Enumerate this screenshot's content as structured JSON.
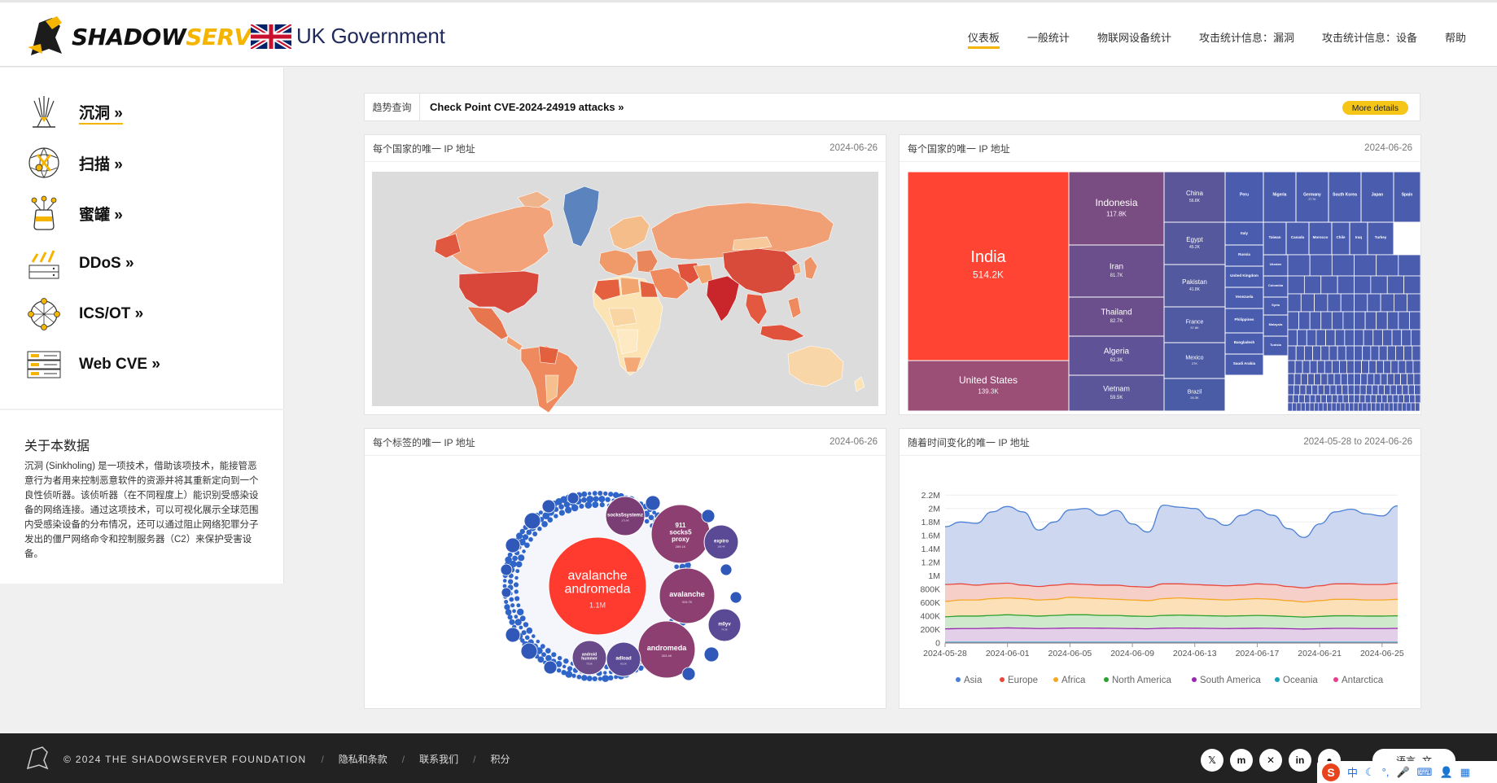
{
  "header": {
    "logo": {
      "part1": "SHADOW",
      "part2": "SERVER"
    },
    "partner": "UK Government",
    "nav": [
      {
        "label": "仪表板",
        "active": true
      },
      {
        "label": "一般统计"
      },
      {
        "label": "物联网设备统计"
      },
      {
        "label": "攻击统计信息：漏洞"
      },
      {
        "label": "攻击统计信息：设备"
      },
      {
        "label": "帮助"
      }
    ]
  },
  "sidebar": {
    "items": [
      {
        "label": "沉洞 »",
        "icon": "sinkhole-icon"
      },
      {
        "label": "扫描 »",
        "icon": "scan-icon"
      },
      {
        "label": "蜜罐 »",
        "icon": "honeypot-icon"
      },
      {
        "label": "DDoS »",
        "icon": "ddos-icon"
      },
      {
        "label": "ICS/OT »",
        "icon": "ics-icon"
      },
      {
        "label": "Web CVE »",
        "icon": "webcve-icon"
      }
    ],
    "about": {
      "title": "关于本数据",
      "text": "沉洞 (Sinkholing) 是一项技术，借助该项技术，能接管恶意行为者用来控制恶意软件的资源并将其重新定向到一个良性侦听器。该侦听器（在不同程度上）能识别受感染设备的网络连接。通过这项技术，可以可视化展示全球范围内受感染设备的分布情况，还可以通过阻止网络犯罪分子发出的僵尸网络命令和控制服务器（C2）来保护受害设备。"
    }
  },
  "trend": {
    "label": "趋势查询",
    "text": "Check Point CVE-2024-24919 attacks »",
    "button": "More details"
  },
  "panels": {
    "map": {
      "title": "每个国家的唯一 IP 地址",
      "date": "2024-06-26"
    },
    "treemap": {
      "title": "每个国家的唯一 IP 地址",
      "date": "2024-06-26"
    },
    "bubbles": {
      "title": "每个标签的唯一 IP 地址",
      "date": "2024-06-26"
    },
    "timeseries": {
      "title": "随着时间变化的唯一 IP 地址",
      "date": "2024-05-28 to 2024-06-26"
    }
  },
  "colors": {
    "accent": "#f5b400",
    "india": "#ff4433",
    "treemap_blue": "#4a5cae",
    "treemap_purple": "#6b5aa0"
  },
  "chart_data": [
    {
      "type": "treemap",
      "title": "每个国家的唯一 IP 地址",
      "items": [
        {
          "name": "India",
          "value": "514.2K"
        },
        {
          "name": "United States",
          "value": "139.3K"
        },
        {
          "name": "Indonesia",
          "value": "117.8K"
        },
        {
          "name": "Iran",
          "value": "81.7K"
        },
        {
          "name": "Thailand",
          "value": "82.7K"
        },
        {
          "name": "Algeria",
          "value": "62.3K"
        },
        {
          "name": "Vietnam",
          "value": "59.5K"
        },
        {
          "name": "China",
          "value": "56.8K"
        },
        {
          "name": "Egypt",
          "value": "45.2K"
        },
        {
          "name": "Pakistan",
          "value": "41.8K"
        },
        {
          "name": "France",
          "value": "37.8K"
        },
        {
          "name": "Mexico",
          "value": "27K"
        },
        {
          "name": "Brazil",
          "value": "26.3K"
        },
        {
          "name": "Peru",
          "value": "",
          "short": true
        },
        {
          "name": "Nigeria",
          "value": ""
        },
        {
          "name": "Germany",
          "value": "27.7K"
        },
        {
          "name": "South Korea",
          "value": ""
        },
        {
          "name": "Japan",
          "value": ""
        },
        {
          "name": "Spain",
          "value": ""
        },
        {
          "name": "Italy",
          "value": ""
        },
        {
          "name": "Taiwan",
          "value": ""
        },
        {
          "name": "Canada",
          "value": ""
        },
        {
          "name": "Morocco",
          "value": ""
        },
        {
          "name": "Chile",
          "value": ""
        },
        {
          "name": "Iraq",
          "value": ""
        },
        {
          "name": "Turkey",
          "value": ""
        },
        {
          "name": "Russia",
          "value": ""
        },
        {
          "name": "United Kingdom",
          "value": ""
        },
        {
          "name": "Venezuela",
          "value": ""
        },
        {
          "name": "Philippines",
          "value": ""
        },
        {
          "name": "Bangladesh",
          "value": ""
        },
        {
          "name": "Saudi Arabia",
          "value": ""
        },
        {
          "name": "Colombia",
          "value": ""
        },
        {
          "name": "Ukraine",
          "value": ""
        },
        {
          "name": "Syria",
          "value": ""
        },
        {
          "name": "Malaysia",
          "value": ""
        },
        {
          "name": "Tunisia",
          "value": ""
        }
      ]
    },
    {
      "type": "bubble",
      "title": "每个标签的唯一 IP 地址",
      "items": [
        {
          "name": "avalanche andromeda",
          "lines": [
            "avalanche",
            "andromeda"
          ],
          "value": "1.1M"
        },
        {
          "name": "911 socks5 proxy",
          "lines": [
            "911",
            "socks5",
            "proxy"
          ],
          "value": "289.1K"
        },
        {
          "name": "avalanche",
          "lines": [
            "avalanche"
          ],
          "value": "319.7K"
        },
        {
          "name": "andromeda",
          "lines": [
            "andromeda"
          ],
          "value": "303.4K"
        },
        {
          "name": "socks5systemz",
          "lines": [
            "socks5systemz"
          ],
          "value": "173.8K"
        },
        {
          "name": "expiro",
          "lines": [
            "expiro"
          ],
          "value": "105.4K"
        },
        {
          "name": "m0yv",
          "lines": [
            "m0yv"
          ],
          "value": "74.3K"
        },
        {
          "name": "adload",
          "lines": [
            "adload"
          ],
          "value": "60.2K"
        },
        {
          "name": "android hummer",
          "lines": [
            "android",
            "hummer"
          ],
          "value": "73.5K"
        }
      ]
    },
    {
      "type": "area",
      "title": "随着时间变化的唯一 IP 地址",
      "stacked": true,
      "x_ticks": [
        "2024-05-28",
        "2024-06-01",
        "2024-06-05",
        "2024-06-09",
        "2024-06-13",
        "2024-06-17",
        "2024-06-21",
        "2024-06-25"
      ],
      "y_ticks": [
        "0",
        "200K",
        "400K",
        "600K",
        "800K",
        "1M",
        "1.2M",
        "1.4M",
        "1.6M",
        "1.8M",
        "2M",
        "2.2M"
      ],
      "ylim": [
        0,
        2300000
      ],
      "x_start": "2024-05-28",
      "x_end": "2024-06-26",
      "series": [
        {
          "name": "Asia",
          "color": "#4a7fd6",
          "values": [
            1730000,
            1800000,
            1780000,
            1950000,
            2030000,
            1950000,
            1680000,
            1800000,
            1980000,
            2000000,
            1900000,
            1970000,
            1770000,
            1650000,
            2050000,
            2020000,
            2000000,
            1850000,
            1750000,
            1900000,
            1980000,
            1900000,
            1700000,
            1570000,
            1770000,
            1950000,
            1990000,
            1920000,
            1890000,
            2040000
          ]
        },
        {
          "name": "Europe",
          "color": "#e8473c",
          "values": [
            870000,
            880000,
            860000,
            880000,
            890000,
            860000,
            840000,
            860000,
            880000,
            870000,
            860000,
            860000,
            840000,
            830000,
            880000,
            880000,
            870000,
            860000,
            850000,
            860000,
            880000,
            870000,
            840000,
            820000,
            850000,
            880000,
            880000,
            870000,
            870000,
            890000
          ]
        },
        {
          "name": "Africa",
          "color": "#f5a623",
          "values": [
            620000,
            640000,
            640000,
            660000,
            670000,
            660000,
            640000,
            650000,
            680000,
            670000,
            660000,
            650000,
            640000,
            630000,
            660000,
            670000,
            660000,
            650000,
            640000,
            650000,
            660000,
            650000,
            630000,
            610000,
            630000,
            650000,
            650000,
            640000,
            640000,
            650000
          ]
        },
        {
          "name": "North America",
          "color": "#2ca02c",
          "values": [
            390000,
            400000,
            400000,
            410000,
            420000,
            410000,
            400000,
            410000,
            420000,
            420000,
            410000,
            410000,
            400000,
            395000,
            410000,
            415000,
            410000,
            405000,
            400000,
            405000,
            410000,
            405000,
            395000,
            385000,
            395000,
            405000,
            405000,
            400000,
            400000,
            405000
          ]
        },
        {
          "name": "South America",
          "color": "#9b27b0",
          "values": [
            210000,
            215000,
            215000,
            220000,
            225000,
            220000,
            215000,
            218000,
            222000,
            222000,
            220000,
            218000,
            215000,
            212000,
            220000,
            222000,
            220000,
            218000,
            215000,
            217000,
            220000,
            218000,
            213000,
            208000,
            213000,
            218000,
            218000,
            215000,
            215000,
            218000
          ]
        },
        {
          "name": "Oceania",
          "color": "#17a2b8",
          "values": [
            10000,
            10000,
            10000,
            10000,
            10000,
            10000,
            10000,
            10000,
            10000,
            10000,
            10000,
            10000,
            10000,
            10000,
            10000,
            10000,
            10000,
            10000,
            10000,
            10000,
            10000,
            10000,
            10000,
            10000,
            10000,
            10000,
            10000,
            10000,
            10000,
            10000
          ]
        },
        {
          "name": "Antarctica",
          "color": "#e83e8c",
          "values": [
            100,
            100,
            100,
            100,
            100,
            100,
            100,
            100,
            100,
            100,
            100,
            100,
            100,
            100,
            100,
            100,
            100,
            100,
            100,
            100,
            100,
            100,
            100,
            100,
            100,
            100,
            100,
            100,
            100,
            100
          ]
        }
      ]
    }
  ],
  "footer": {
    "copyright": "© 2024 THE SHADOWSERVER FOUNDATION",
    "links": [
      "隐私和条款",
      "联系我们",
      "积分"
    ],
    "socials": [
      "x-icon",
      "mastodon-icon",
      "bluesky-icon",
      "linkedin-icon",
      "github-icon"
    ],
    "language": "语言"
  },
  "ime": {
    "mode": "中"
  }
}
